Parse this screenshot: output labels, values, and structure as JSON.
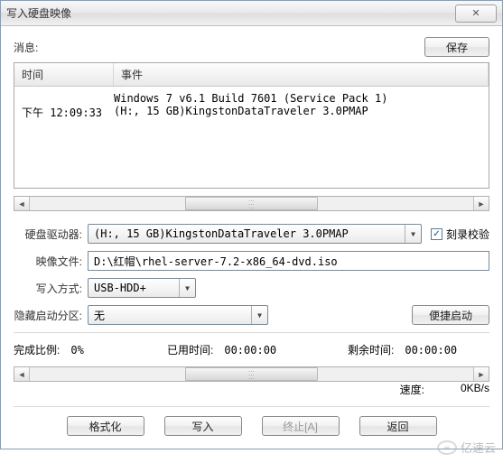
{
  "window": {
    "title": "写入硬盘映像",
    "close_glyph": "✕"
  },
  "msg": {
    "label": "消息:",
    "save": "保存"
  },
  "log": {
    "col_time": "时间",
    "col_event": "事件",
    "rows": [
      {
        "time": "",
        "event": "Windows 7 v6.1 Build 7601 (Service Pack 1)"
      },
      {
        "time": "下午 12:09:33",
        "event": "(H:, 15 GB)KingstonDataTraveler 3.0PMAP"
      }
    ]
  },
  "form": {
    "drive_label": "硬盘驱动器:",
    "drive_value": "(H:, 15 GB)KingstonDataTraveler 3.0PMAP",
    "verify_label": "刻录校验",
    "verify_checked": true,
    "image_label": "映像文件:",
    "image_value": "D:\\红帽\\rhel-server-7.2-x86_64-dvd.iso",
    "write_label": "写入方式:",
    "write_value": "USB-HDD+",
    "hide_label": "隐藏启动分区:",
    "hide_value": "无",
    "quick_boot": "便捷启动"
  },
  "status": {
    "pct_label": "完成比例:",
    "pct": "0%",
    "elapsed_label": "已用时间:",
    "elapsed": "00:00:00",
    "remain_label": "剩余时间:",
    "remain": "00:00:00",
    "speed_label": "速度:",
    "speed": "0KB/s"
  },
  "buttons": {
    "format": "格式化",
    "write": "写入",
    "abort": "终止[A]",
    "back": "返回"
  },
  "watermark": "亿速云"
}
